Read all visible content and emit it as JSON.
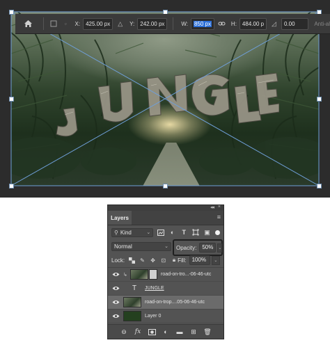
{
  "options_bar": {
    "home_icon": "home-icon",
    "x_label": "X:",
    "x_value": "425.00 px",
    "y_label": "Y:",
    "y_value": "242.00 px",
    "w_label": "W:",
    "w_value": "850 px",
    "h_label": "H:",
    "h_value": "484.00 p",
    "angle_value": "0.00",
    "trailing_text": "Anti-al"
  },
  "canvas": {
    "word": "JUNGLE",
    "transform_color": "#6f9fd8"
  },
  "layers_panel": {
    "tab_label": "Layers",
    "filter_kind": "Kind",
    "blend_mode": "Normal",
    "opacity_label": "Opacity:",
    "opacity_value": "50%",
    "lock_label": "Lock:",
    "fill_label": "Fill:",
    "fill_value": "100%",
    "layers": [
      {
        "name": "road-on-tro...-06-46-utc",
        "kind": "image",
        "clipped": true,
        "selected": false
      },
      {
        "name": "JUNGLE",
        "kind": "text",
        "clipped": false,
        "selected": false
      },
      {
        "name": "road-on-trop....05-06-46-utc",
        "kind": "image",
        "clipped": false,
        "selected": true
      },
      {
        "name": "Layer 0",
        "kind": "fill",
        "clipped": false,
        "selected": false
      }
    ]
  }
}
